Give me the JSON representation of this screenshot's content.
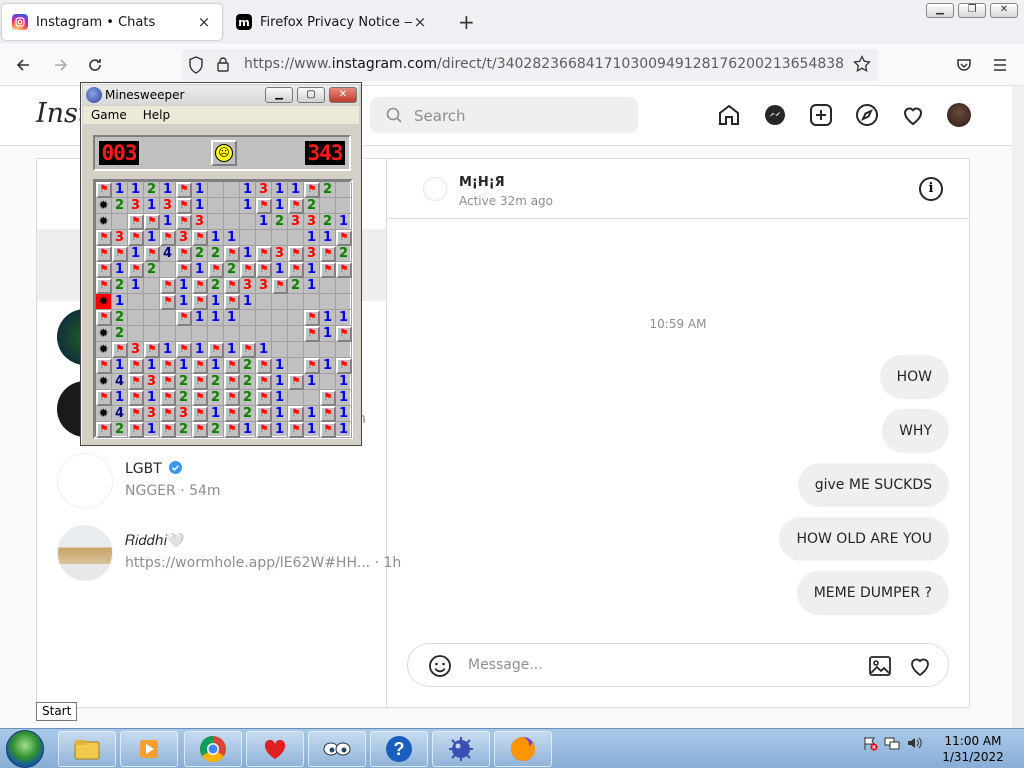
{
  "browser": {
    "tabs": [
      {
        "title": "Instagram • Chats",
        "close": "×"
      },
      {
        "title": "Firefox Privacy Notice — Mozilla",
        "close": "×"
      }
    ],
    "new_tab": "+",
    "url_prefix": "https://www.",
    "url_host": "instagram.com",
    "url_path": "/direct/t/340282366841710300949128176200213654838"
  },
  "instagram": {
    "logo": "Insta",
    "search_placeholder": "Search",
    "conversations": [
      {
        "name": "LGBT",
        "verified": true,
        "preview": "NGGER · 54m"
      },
      {
        "name": "𝑅𝑖𝑑𝑑ℎ𝑖🤍",
        "preview": "https://wormhole.app/lE62W#HH... · 1h"
      }
    ],
    "partial_time": "n",
    "chat": {
      "name": "M¡H¡Я",
      "status": "Active 32m ago",
      "timestamp": "10:59 AM",
      "messages": [
        "HOW",
        "WHY",
        "give ME SUCKDS",
        "HOW OLD ARE YOU",
        "MEME DUMPER ?"
      ],
      "composer_placeholder": "Message..."
    }
  },
  "minesweeper": {
    "title": "Minesweeper",
    "menu": [
      "Game",
      "Help"
    ],
    "mines_left": "003",
    "timer": "343",
    "face": "sad",
    "rows": [
      "H1121H1..1311H2...",
      "M2313H1..1H1H2....",
      "M.HH1H3...123321..",
      "H3H1H3H11....11H1.",
      "HH1H4H22H1H3H3H2H1H122H1",
      "H1H2.H1H2HH1H1HH1...",
      "H21.H1H2H33H21....",
      "R1..H1H1H1........",
      "H2...H111....H1121",
      "M2...........H1H1H2H1",
      "MH3H1H1H1H1......H1121",
      "H1H1H1H1H2H1.H1H1H1....",
      "M4H3H2H2H2H1H1.1H12H11H1H1",
      "H1H1H2H2H2H1..H1H12H11H1H1",
      "M4H3H3H1H2H1H1H1H1H1H2H3H3H2",
      "H2H1H2H2H1H1H1H1..H1H1H1"
    ]
  },
  "taskbar": {
    "start_tooltip": "Start",
    "time": "11:00 AM",
    "date": "1/31/2022"
  }
}
